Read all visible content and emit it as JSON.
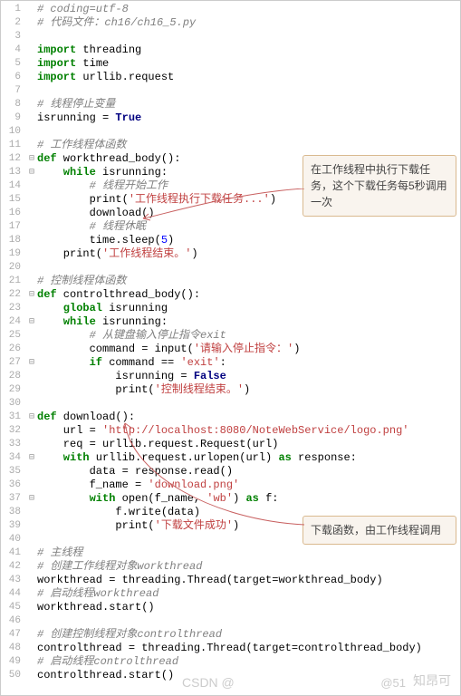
{
  "lines": {
    "l1": "# coding=utf-8",
    "l2": "# 代码文件：ch16/ch16_5.py",
    "l3": "",
    "l4a": "import",
    "l4b": " threading",
    "l5a": "import",
    "l5b": " time",
    "l6a": "import",
    "l6b": " urllib.request",
    "l8": "# 线程停止变量",
    "l9a": "isrunning = ",
    "l9b": "True",
    "l11": "# 工作线程体函数",
    "l12a": "def",
    "l12b": " workthread_body():",
    "l13a": "    while",
    "l13b": " isrunning:",
    "l14": "        # 线程开始工作",
    "l15a": "        print(",
    "l15b": "'工作线程执行下载任务...'",
    "l15c": ")",
    "l16": "        download()",
    "l17": "        # 线程休眠",
    "l18a": "        time.sleep(",
    "l18b": "5",
    "l18c": ")",
    "l19a": "    print(",
    "l19b": "'工作线程结束。'",
    "l19c": ")",
    "l21": "# 控制线程体函数",
    "l22a": "def",
    "l22b": " controlthread_body():",
    "l23a": "    global",
    "l23b": " isrunning",
    "l24a": "    while",
    "l24b": " isrunning:",
    "l25": "        # 从键盘输入停止指令exit",
    "l26a": "        command = input(",
    "l26b": "'请输入停止指令：'",
    "l26c": ")",
    "l27a": "        if",
    "l27b": " command == ",
    "l27c": "'exit'",
    "l27d": ":",
    "l28a": "            isrunning = ",
    "l28b": "False",
    "l29a": "            print(",
    "l29b": "'控制线程结束。'",
    "l29c": ")",
    "l31a": "def",
    "l31b": " download():",
    "l32a": "    url = ",
    "l32b": "'http://localhost:8080/NoteWebService/logo.png'",
    "l33": "    req = urllib.request.Request(url)",
    "l34a": "    with",
    "l34b": " urllib.request.urlopen(url) ",
    "l34c": "as",
    "l34d": " response:",
    "l35": "        data = response.read()",
    "l36a": "        f_name = ",
    "l36b": "'download.png'",
    "l37a": "        with",
    "l37b": " open(f_name, ",
    "l37c": "'wb'",
    "l37d": ") ",
    "l37e": "as",
    "l37f": " f:",
    "l38": "            f.write(data)",
    "l39a": "            print(",
    "l39b": "'下载文件成功'",
    "l39c": ")",
    "l41": "# 主线程",
    "l42": "# 创建工作线程对象workthread",
    "l43": "workthread = threading.Thread(target=workthread_body)",
    "l44": "# 启动线程workthread",
    "l45": "workthread.start()",
    "l47": "# 创建控制线程对象controlthread",
    "l48": "controlthread = threading.Thread(target=controlthread_body)",
    "l49": "# 启动线程controlthread",
    "l50": "controlthread.start()"
  },
  "callouts": {
    "a": "在工作线程中执行下载任务，这个下载任务每5秒调用一次",
    "b": "下载函数，由工作线程调用"
  },
  "watermark": {
    "center": "CSDN @",
    "right": "知昂可",
    "right2": "@51"
  }
}
